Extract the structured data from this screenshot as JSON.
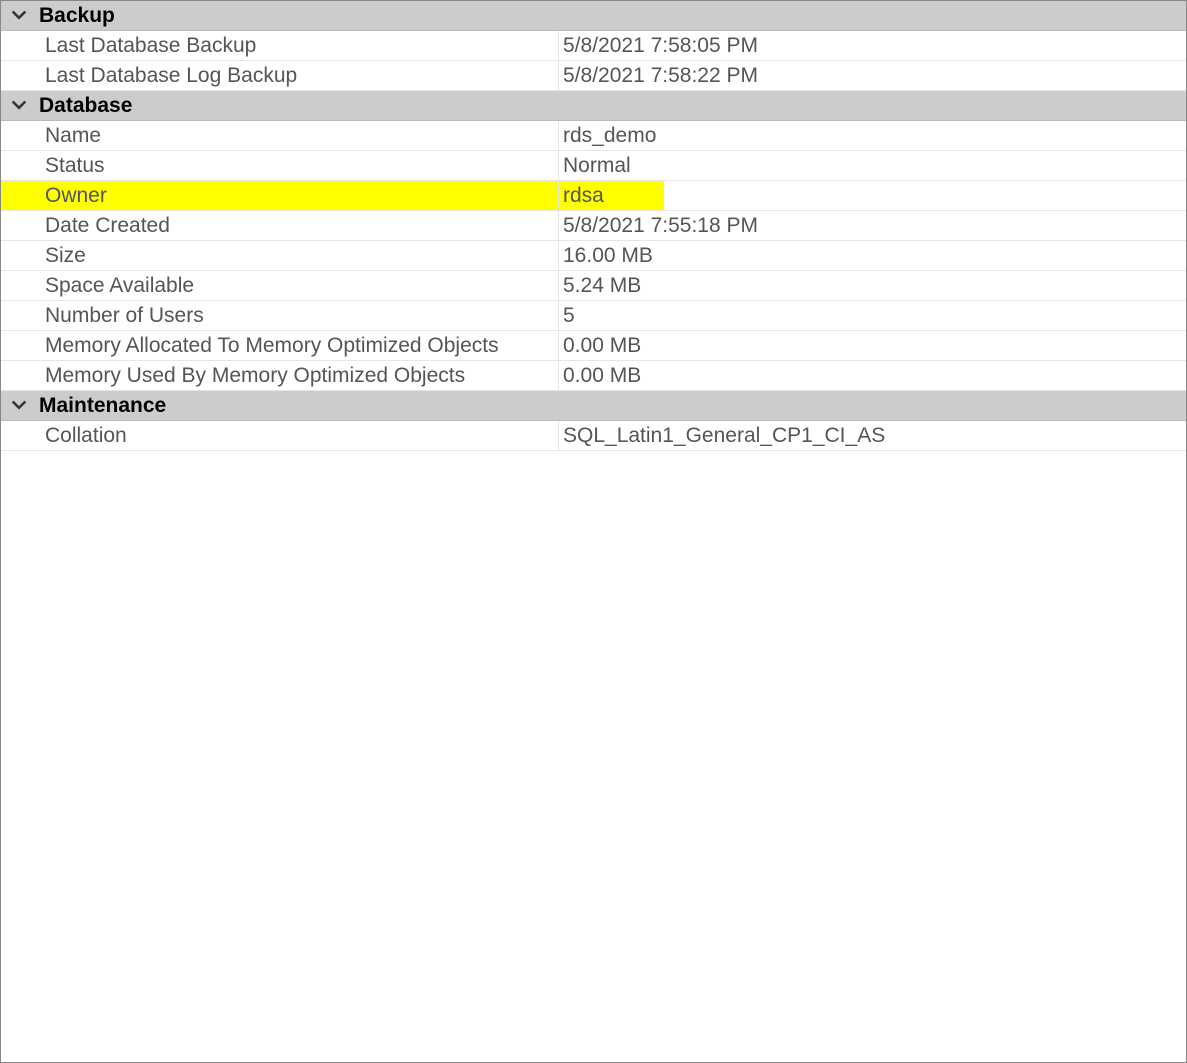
{
  "sections": {
    "backup": {
      "title": "Backup",
      "rows": [
        {
          "label": "Last Database Backup",
          "value": "5/8/2021 7:58:05 PM"
        },
        {
          "label": "Last Database Log Backup",
          "value": "5/8/2021 7:58:22 PM"
        }
      ]
    },
    "database": {
      "title": "Database",
      "rows": [
        {
          "label": "Name",
          "value": "rds_demo"
        },
        {
          "label": "Status",
          "value": "Normal"
        },
        {
          "label": "Owner",
          "value": "rdsa"
        },
        {
          "label": "Date Created",
          "value": "5/8/2021 7:55:18 PM"
        },
        {
          "label": "Size",
          "value": "16.00 MB"
        },
        {
          "label": "Space Available",
          "value": "5.24 MB"
        },
        {
          "label": "Number of Users",
          "value": "5"
        },
        {
          "label": "Memory Allocated To Memory Optimized Objects",
          "value": "0.00 MB"
        },
        {
          "label": "Memory Used By Memory Optimized Objects",
          "value": "0.00 MB"
        }
      ]
    },
    "maintenance": {
      "title": "Maintenance",
      "rows": [
        {
          "label": "Collation",
          "value": "SQL_Latin1_General_CP1_CI_AS"
        }
      ]
    }
  }
}
